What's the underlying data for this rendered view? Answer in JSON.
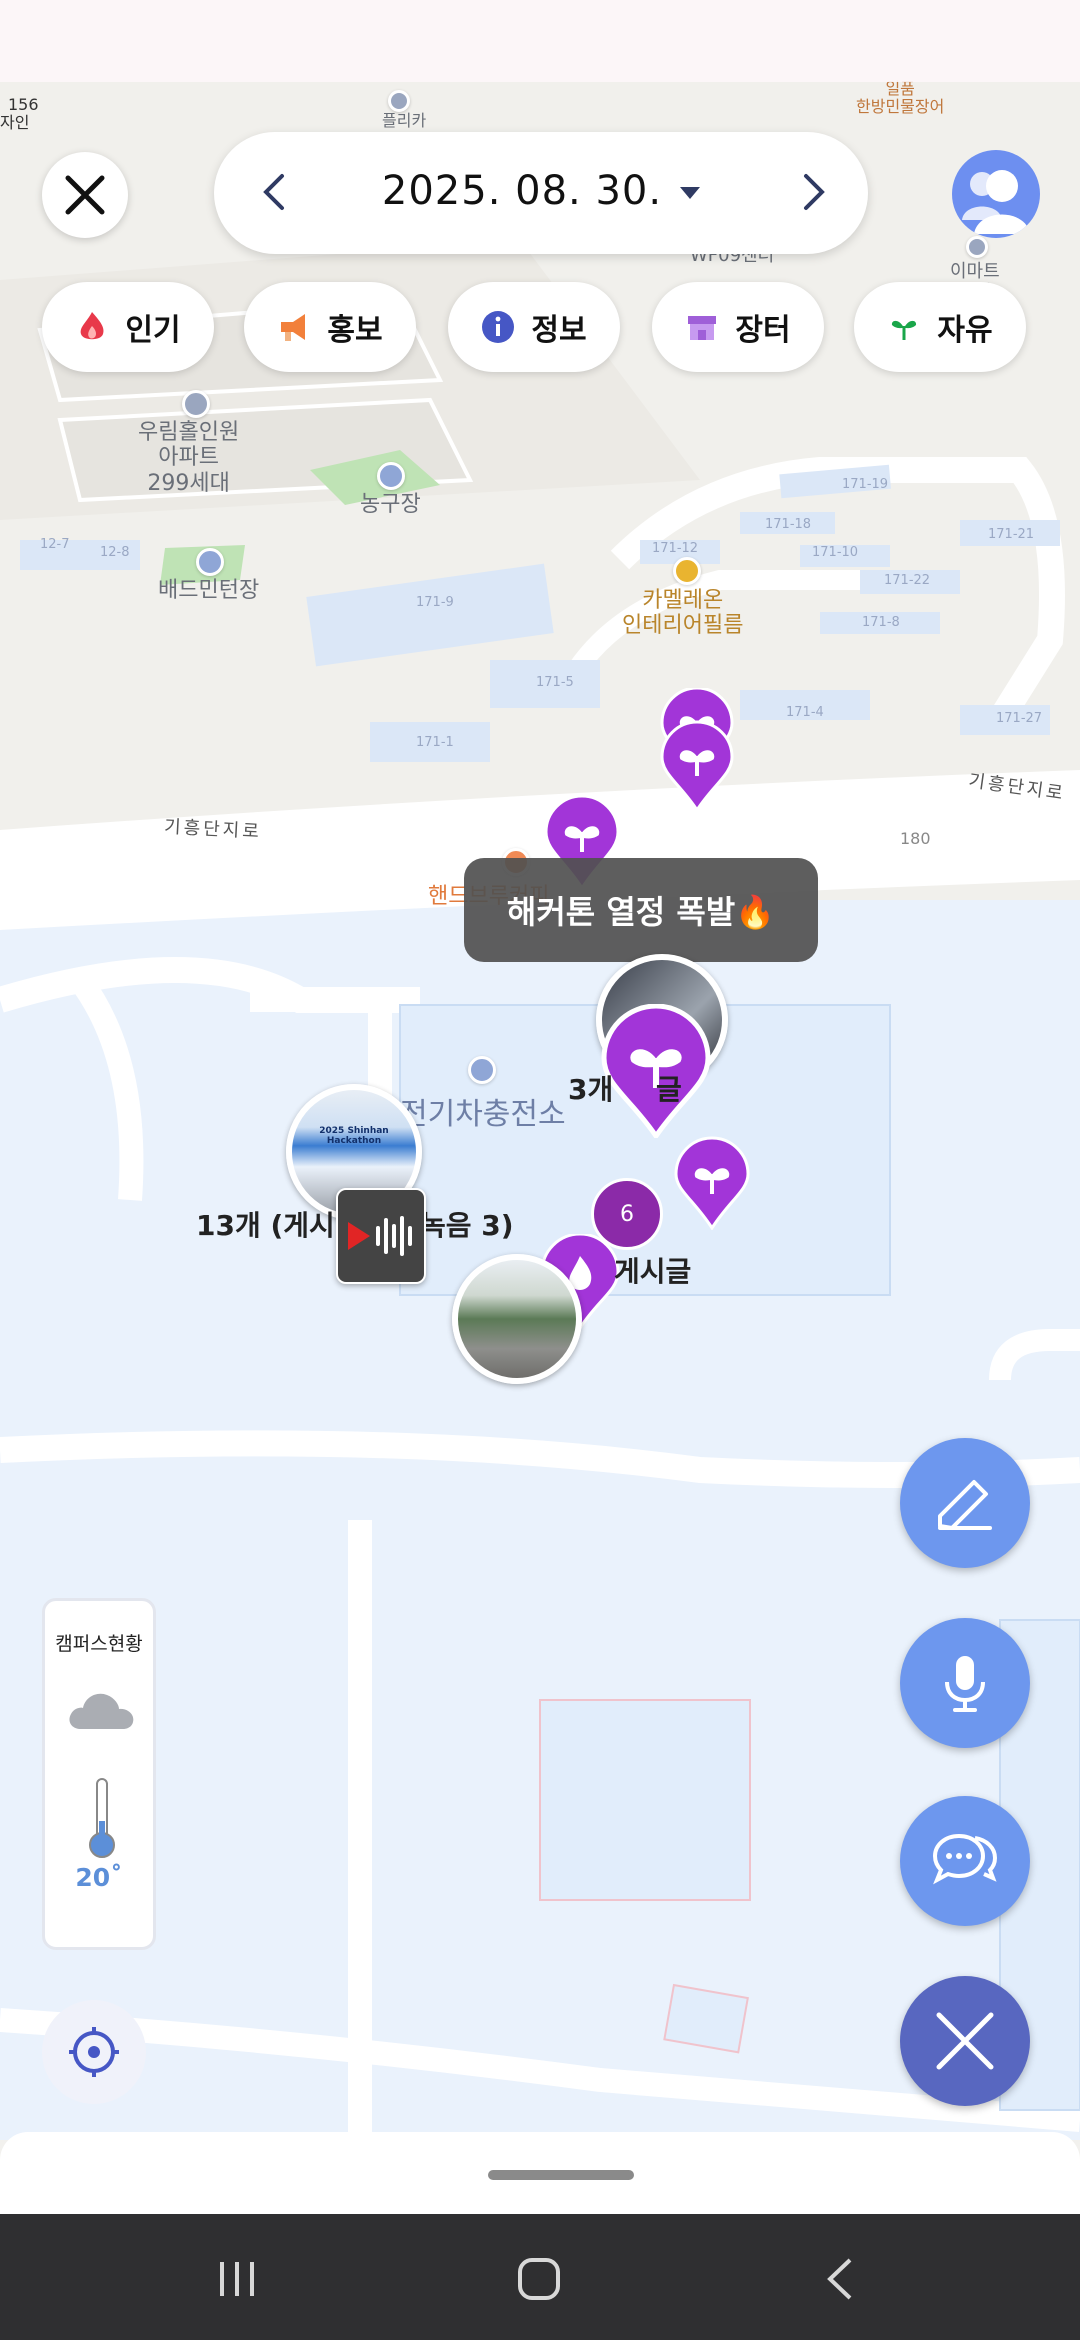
{
  "header": {
    "date": "2025. 08. 30."
  },
  "categories": [
    {
      "label": "인기",
      "icon": "fire-icon"
    },
    {
      "label": "홍보",
      "icon": "megaphone-icon"
    },
    {
      "label": "정보",
      "icon": "info-icon"
    },
    {
      "label": "장터",
      "icon": "shop-icon"
    },
    {
      "label": "자유",
      "icon": "sprout-icon"
    }
  ],
  "map": {
    "labels": {
      "apartment": "우림홀인원\n아파트\n299세대",
      "basketball": "농구장",
      "badminton": "배드민턴장",
      "interior": "카멜레온\n인테리어필름",
      "handbrew": "핸드브루커피",
      "ev_charger": "전기차충전소",
      "road1": "기흥단지로",
      "road2": "기흥단지로",
      "wf09": "WF09센터",
      "emart": "이마트\n센터",
      "plika": "플리카",
      "ilpum": "일품\n한방민물장어",
      "num156": "156",
      "design": "자인",
      "lot_171_19": "171-19",
      "lot_171_18": "171-18",
      "lot_171_21": "171-21",
      "lot_171_12": "171-12",
      "lot_171_10": "171-10",
      "lot_171_22": "171-22",
      "lot_171_9": "171-9",
      "lot_171_8": "171-8",
      "lot_171_5": "171-5",
      "lot_171_4": "171-4",
      "lot_171_27": "171-27",
      "lot_171_1": "171-1",
      "lot_180": "180",
      "lot_12_7": "12-7",
      "lot_12_8": "12-8"
    },
    "bubble": "해커톤 열정 폭발🔥",
    "cluster_count": "6",
    "label_3": "3개",
    "label_3b": "글",
    "label_13": "13개 (게시",
    "label_13b": "녹음 3)",
    "label_posts": "게시글",
    "photo_text": "2025 Shinhan Hackathon"
  },
  "weather": {
    "title": "캠퍼스현황",
    "temperature": "20˚",
    "icon": "cloud-icon"
  },
  "colors": {
    "accent": "#6d97ee",
    "pin": "#a235d8",
    "close_fab": "#5867c0"
  }
}
